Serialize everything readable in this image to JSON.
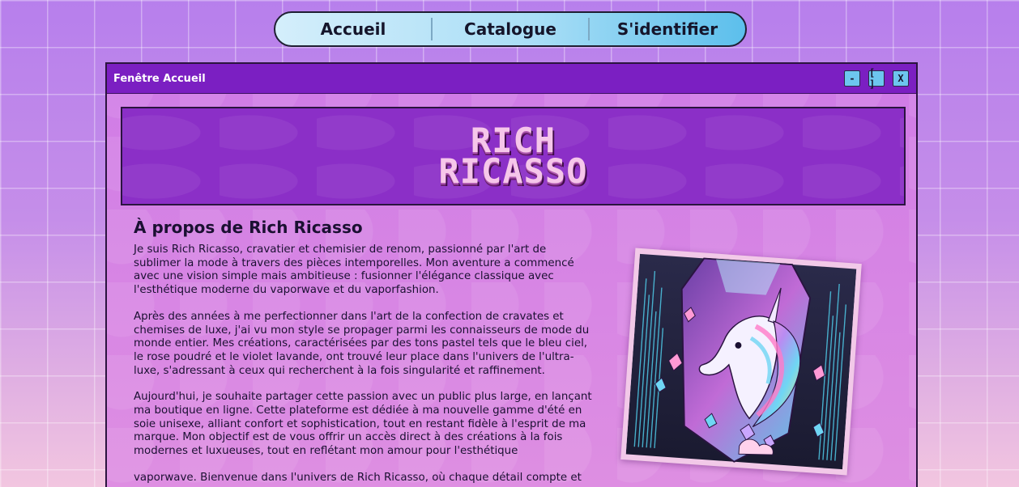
{
  "nav": {
    "items": [
      {
        "label": "Accueil"
      },
      {
        "label": "Catalogue"
      },
      {
        "label": "S'identifier"
      }
    ]
  },
  "window": {
    "title": "Fenêtre Accueil",
    "buttons": {
      "minimize": "-",
      "maximize": "[ ]",
      "close": "X"
    }
  },
  "banner": {
    "logo_line1": "RICH",
    "logo_line2": "RICASSO"
  },
  "about": {
    "heading": "À propos de Rich Ricasso",
    "paragraphs": [
      "Je suis Rich Ricasso, cravatier et chemisier de renom, passionné par l'art de sublimer la mode à travers des pièces intemporelles. Mon aventure a commencé avec une vision simple mais ambitieuse : fusionner l'élégance classique avec l'esthétique moderne du vaporwave et du vaporfashion.",
      "Après des années à me perfectionner dans l'art de la confection de cravates et chemises de luxe, j'ai vu mon style se propager parmi les connaisseurs de mode du monde entier. Mes créations, caractérisées par des tons pastel tels que le bleu ciel, le rose poudré et le violet lavande, ont trouvé leur place dans l'univers de l'ultra-luxe, s'adressant à ceux qui recherchent à la fois singularité et raffinement.",
      "Aujourd'hui, je souhaite partager cette passion avec un public plus large, en lançant ma boutique en ligne. Cette plateforme est dédiée à ma nouvelle gamme d'été en soie unisexe, alliant confort et sophistication, tout en restant fidèle à l'esprit de ma marque. Mon objectif est de vous offrir un accès direct à des créations à la fois modernes et luxueuses, tout en reflétant mon amour pour l'esthétique",
      "vaporwave. Bienvenue dans l'univers de Rich Ricasso, où chaque détail compte et"
    ]
  },
  "artwork": {
    "icon": "unicorn-tie-artwork"
  },
  "colors": {
    "titlebar": "#7b1fc2",
    "banner": "#8b2fc7",
    "nav_accent": "#5cbfec",
    "window_button": "#6dc6ef"
  }
}
